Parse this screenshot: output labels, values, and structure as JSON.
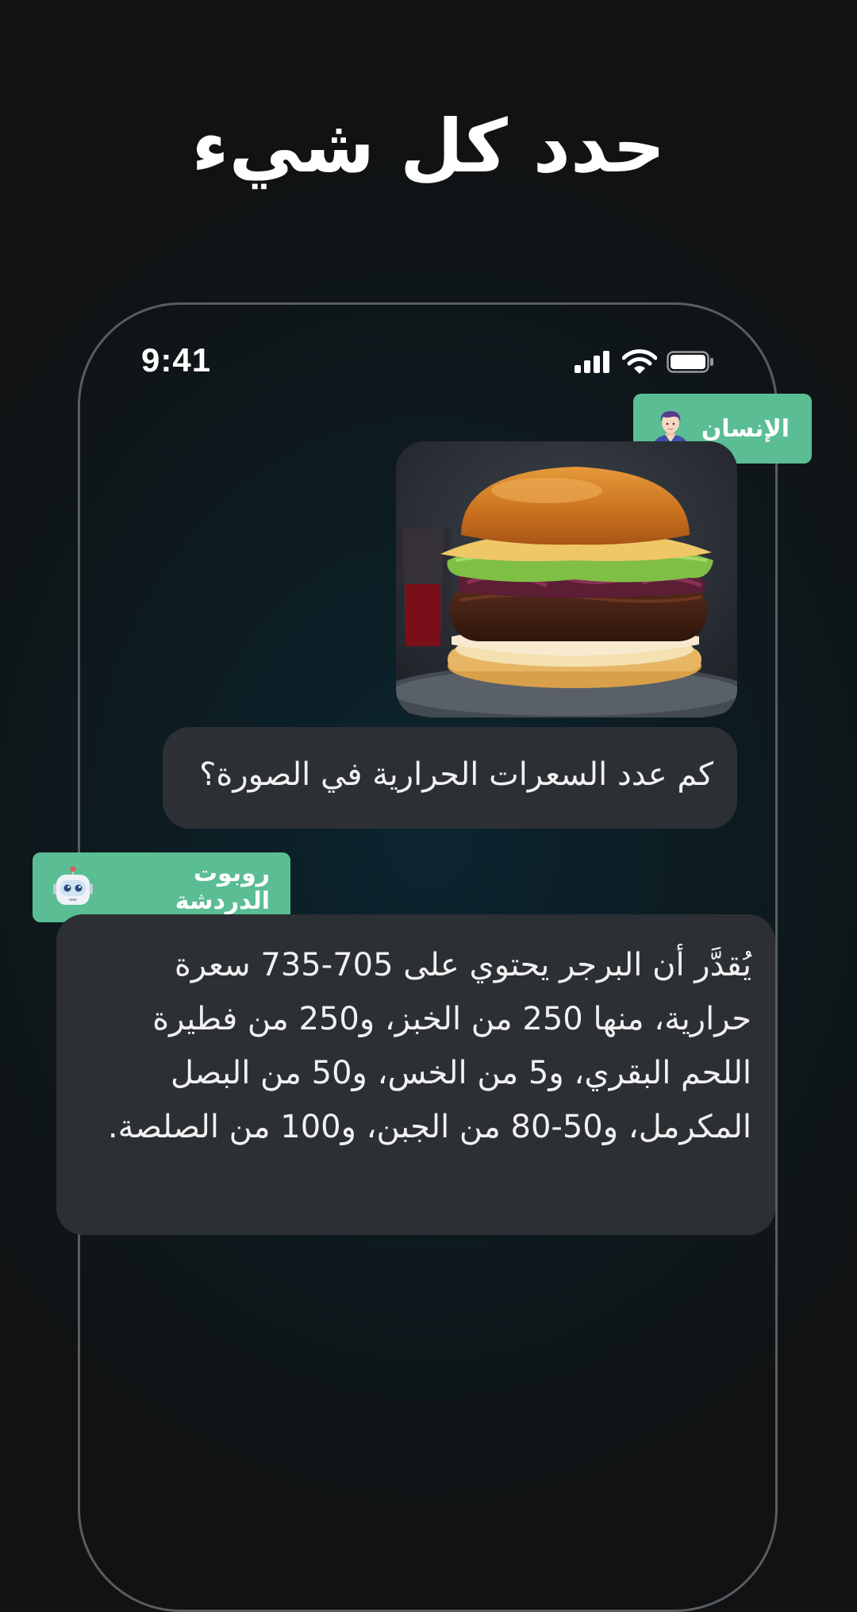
{
  "headline": "حدد كل شيء",
  "status_bar": {
    "time": "9:41"
  },
  "chat": {
    "user_label": "الإنسان",
    "user_question": "كم عدد السعرات الحرارية في الصورة؟",
    "bot_label": "روبوت الدردشة",
    "bot_answer": "يُقدَّر أن البرجر يحتوي على 705-735 سعرة حرارية، منها 250 من الخبز، و250 من فطيرة اللحم البقري، و5 من الخس، و50 من البصل المكرمل، و50-80 من الجبن، و100 من الصلصة."
  },
  "icons": {
    "user_avatar": "person-avatar-icon",
    "bot_avatar": "robot-icon",
    "signal": "cellular-signal-icon",
    "wifi": "wifi-icon",
    "battery": "battery-icon"
  },
  "colors": {
    "tag_green": "#5bbd94",
    "bubble": "#2c2f33",
    "background": "#111213"
  }
}
